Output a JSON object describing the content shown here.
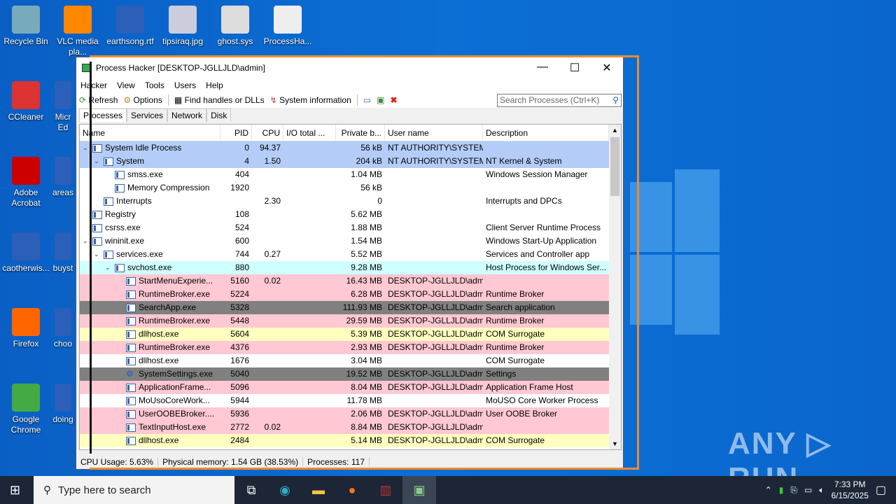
{
  "desktop": {
    "icons_left": [
      "Recycle Bin",
      "CCleaner",
      "Adobe Acrobat",
      "caotherwis...",
      "Firefox",
      "Google Chrome"
    ],
    "icons_col2": [
      "Micr Ed",
      "areas",
      "buyst",
      "choo",
      "doing"
    ],
    "icons_top": [
      "VLC media pla...",
      "earthsong.rtf",
      "tipsiraq.jpg",
      "ghost.sys",
      "ProcessHa..."
    ]
  },
  "window": {
    "title": "Process Hacker [DESKTOP-JGLLJLD\\admin]",
    "minimize": "—",
    "maximize": "☐",
    "close": "✕",
    "menu": [
      "Hacker",
      "View",
      "Tools",
      "Users",
      "Help"
    ],
    "toolbar": {
      "refresh": "Refresh",
      "options": "Options",
      "find": "Find handles or DLLs",
      "sysinfo": "System information",
      "search_placeholder": "Search Processes (Ctrl+K)"
    },
    "tabs": [
      "Processes",
      "Services",
      "Network",
      "Disk"
    ],
    "columns": [
      "Name",
      "PID",
      "CPU",
      "I/O total ...",
      "Private b...",
      "User name",
      "Description"
    ],
    "colors": {
      "system": "#b4cdf8",
      "service": "#d0ffff",
      "own": "#ffc8d2",
      "suspended": "#808080",
      "dll": "#ffffc0",
      "normal": "#ffffff"
    },
    "rows": [
      {
        "name": "System Idle Process",
        "pid": "0",
        "cpu": "94.37",
        "io": "",
        "priv": "56 kB",
        "user": "NT AUTHORITY\\SYSTEM",
        "desc": "",
        "lvl": 0,
        "exp": true,
        "kind": "system"
      },
      {
        "name": "System",
        "pid": "4",
        "cpu": "1.50",
        "io": "",
        "priv": "204 kB",
        "user": "NT AUTHORITY\\SYSTEM",
        "desc": "NT Kernel & System",
        "lvl": 1,
        "exp": true,
        "kind": "system"
      },
      {
        "name": "smss.exe",
        "pid": "404",
        "cpu": "",
        "io": "",
        "priv": "1.04 MB",
        "user": "",
        "desc": "Windows Session Manager",
        "lvl": 2,
        "kind": "normal"
      },
      {
        "name": "Memory Compression",
        "pid": "1920",
        "cpu": "",
        "io": "",
        "priv": "56 kB",
        "user": "",
        "desc": "",
        "lvl": 2,
        "kind": "normal"
      },
      {
        "name": "Interrupts",
        "pid": "",
        "cpu": "2.30",
        "io": "",
        "priv": "0",
        "user": "",
        "desc": "Interrupts and DPCs",
        "lvl": 1,
        "kind": "normal"
      },
      {
        "name": "Registry",
        "pid": "108",
        "cpu": "",
        "io": "",
        "priv": "5.62 MB",
        "user": "",
        "desc": "",
        "lvl": 0,
        "kind": "normal"
      },
      {
        "name": "csrss.exe",
        "pid": "524",
        "cpu": "",
        "io": "",
        "priv": "1.88 MB",
        "user": "",
        "desc": "Client Server Runtime Process",
        "lvl": 0,
        "kind": "normal"
      },
      {
        "name": "wininit.exe",
        "pid": "600",
        "cpu": "",
        "io": "",
        "priv": "1.54 MB",
        "user": "",
        "desc": "Windows Start-Up Application",
        "lvl": 0,
        "exp": true,
        "kind": "normal"
      },
      {
        "name": "services.exe",
        "pid": "744",
        "cpu": "0.27",
        "io": "",
        "priv": "5.52 MB",
        "user": "",
        "desc": "Services and Controller app",
        "lvl": 1,
        "exp": true,
        "kind": "normal"
      },
      {
        "name": "svchost.exe",
        "pid": "880",
        "cpu": "",
        "io": "",
        "priv": "9.28 MB",
        "user": "",
        "desc": "Host Process for Windows Ser...",
        "lvl": 2,
        "exp": true,
        "kind": "service"
      },
      {
        "name": "StartMenuExperie...",
        "pid": "5160",
        "cpu": "0.02",
        "io": "",
        "priv": "16.43 MB",
        "user": "DESKTOP-JGLLJLD\\admi",
        "desc": "",
        "lvl": 3,
        "kind": "own"
      },
      {
        "name": "RuntimeBroker.exe",
        "pid": "5224",
        "cpu": "",
        "io": "",
        "priv": "6.28 MB",
        "user": "DESKTOP-JGLLJLD\\admi",
        "desc": "Runtime Broker",
        "lvl": 3,
        "kind": "own"
      },
      {
        "name": "SearchApp.exe",
        "pid": "5328",
        "cpu": "",
        "io": "",
        "priv": "111.93 MB",
        "user": "DESKTOP-JGLLJLD\\admi",
        "desc": "Search application",
        "lvl": 3,
        "kind": "suspended"
      },
      {
        "name": "RuntimeBroker.exe",
        "pid": "5448",
        "cpu": "",
        "io": "",
        "priv": "29.59 MB",
        "user": "DESKTOP-JGLLJLD\\admi",
        "desc": "Runtime Broker",
        "lvl": 3,
        "kind": "own"
      },
      {
        "name": "dllhost.exe",
        "pid": "5604",
        "cpu": "",
        "io": "",
        "priv": "5.39 MB",
        "user": "DESKTOP-JGLLJLD\\admi",
        "desc": "COM Surrogate",
        "lvl": 3,
        "kind": "dll"
      },
      {
        "name": "RuntimeBroker.exe",
        "pid": "4376",
        "cpu": "",
        "io": "",
        "priv": "2.93 MB",
        "user": "DESKTOP-JGLLJLD\\admi",
        "desc": "Runtime Broker",
        "lvl": 3,
        "kind": "own"
      },
      {
        "name": "dllhost.exe",
        "pid": "1676",
        "cpu": "",
        "io": "",
        "priv": "3.04 MB",
        "user": "",
        "desc": "COM Surrogate",
        "lvl": 3,
        "kind": "normal"
      },
      {
        "name": "SystemSettings.exe",
        "pid": "5040",
        "cpu": "",
        "io": "",
        "priv": "19.52 MB",
        "user": "DESKTOP-JGLLJLD\\admi",
        "desc": "Settings",
        "lvl": 3,
        "kind": "suspended",
        "icon": "gear"
      },
      {
        "name": "ApplicationFrame...",
        "pid": "5096",
        "cpu": "",
        "io": "",
        "priv": "8.04 MB",
        "user": "DESKTOP-JGLLJLD\\admi",
        "desc": "Application Frame Host",
        "lvl": 3,
        "kind": "own"
      },
      {
        "name": "MoUsoCoreWork...",
        "pid": "5944",
        "cpu": "",
        "io": "",
        "priv": "11.78 MB",
        "user": "",
        "desc": "MoUSO Core Worker Process",
        "lvl": 3,
        "kind": "normal"
      },
      {
        "name": "UserOOBEBroker....",
        "pid": "5936",
        "cpu": "",
        "io": "",
        "priv": "2.06 MB",
        "user": "DESKTOP-JGLLJLD\\admi",
        "desc": "User OOBE Broker",
        "lvl": 3,
        "kind": "own"
      },
      {
        "name": "TextInputHost.exe",
        "pid": "2772",
        "cpu": "0.02",
        "io": "",
        "priv": "8.84 MB",
        "user": "DESKTOP-JGLLJLD\\admi",
        "desc": "",
        "lvl": 3,
        "kind": "own"
      },
      {
        "name": "dllhost.exe",
        "pid": "2484",
        "cpu": "",
        "io": "",
        "priv": "5.14 MB",
        "user": "DESKTOP-JGLLJLD\\admi",
        "desc": "COM Surrogate",
        "lvl": 3,
        "kind": "dll"
      }
    ],
    "status": {
      "cpu": "CPU Usage: 5.63%",
      "mem": "Physical memory: 1.54 GB (38.53%)",
      "procs": "Processes: 117"
    }
  },
  "taskbar": {
    "search_placeholder": "Type here to search",
    "time": "7:33 PM",
    "date": "6/15/2025"
  },
  "watermark": "ANY ▷ RUN"
}
